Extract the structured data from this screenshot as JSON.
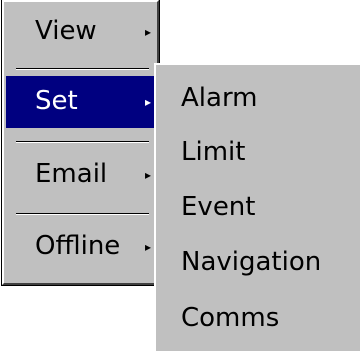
{
  "main_menu": {
    "items": [
      {
        "label": "View",
        "has_submenu": true,
        "selected": false
      },
      {
        "label": "Set",
        "has_submenu": true,
        "selected": true
      },
      {
        "label": "Email",
        "has_submenu": true,
        "selected": false
      },
      {
        "label": "Offline",
        "has_submenu": true,
        "selected": false
      }
    ],
    "arrow_glyph": "▸"
  },
  "submenu": {
    "items": [
      {
        "label": "Alarm"
      },
      {
        "label": "Limit"
      },
      {
        "label": "Event"
      },
      {
        "label": "Navigation"
      },
      {
        "label": "Comms"
      }
    ]
  },
  "colors": {
    "menu_background": "#c0c0c0",
    "selection_background": "#000080",
    "selection_text": "#ffffff",
    "text": "#000000"
  }
}
